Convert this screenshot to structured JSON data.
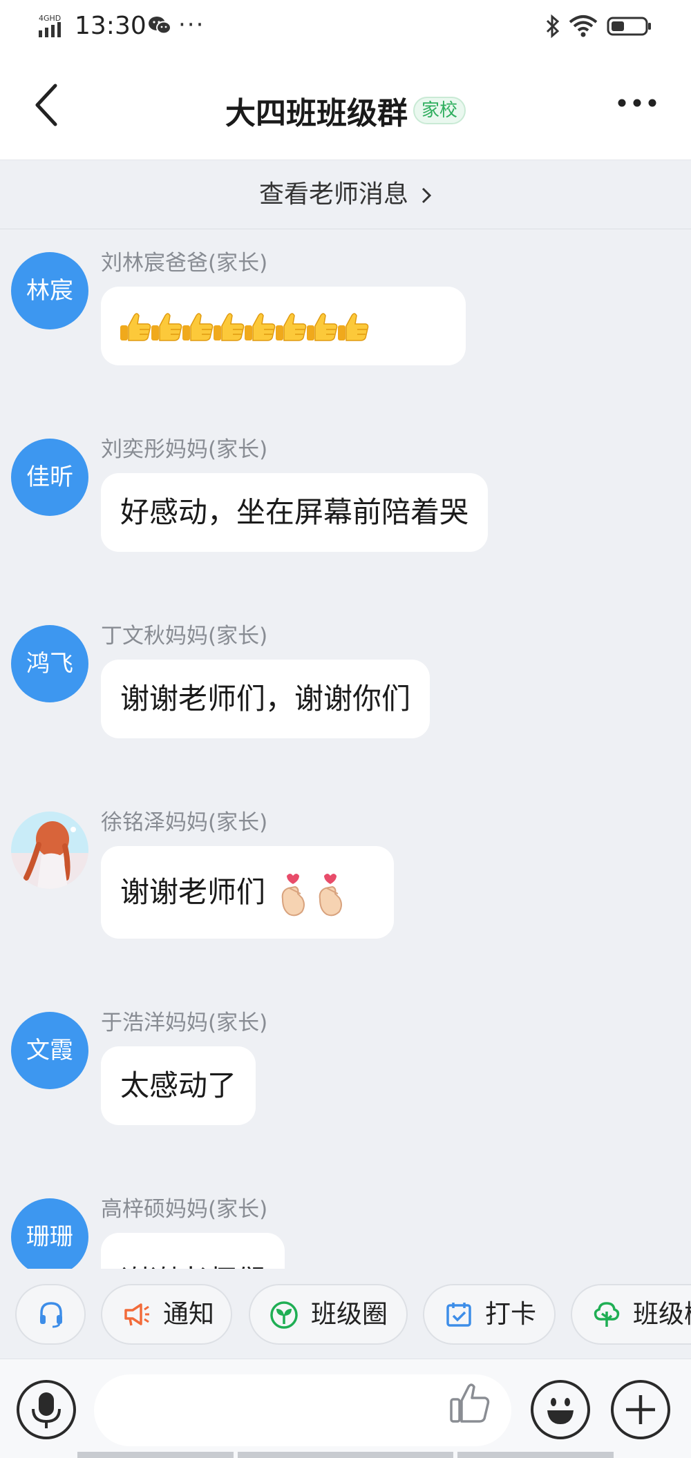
{
  "status_bar": {
    "network": "4G HD",
    "time": "13:30",
    "more": "···"
  },
  "header": {
    "title": "大四班班级群",
    "badge": "家校"
  },
  "teacher_link": {
    "label": "查看老师消息"
  },
  "messages": [
    {
      "avatar_text": "林宸",
      "sender": "刘林宸爸爸(家长)",
      "text": "",
      "emoji": "thumbs-up ×8"
    },
    {
      "avatar_text": "佳昕",
      "sender": "刘奕彤妈妈(家长)",
      "text": "好感动，坐在屏幕前陪着哭"
    },
    {
      "avatar_text": "鸿飞",
      "sender": "丁文秋妈妈(家长)",
      "text": "谢谢老师们，谢谢你们"
    },
    {
      "avatar_text": "",
      "sender": "徐铭泽妈妈(家长)",
      "text": "谢谢老师们",
      "emoji": "finger-heart ×2"
    },
    {
      "avatar_text": "文霞",
      "sender": "于浩洋妈妈(家长)",
      "text": "太感动了"
    },
    {
      "avatar_text": "珊珊",
      "sender": "高梓硕妈妈(家长)",
      "text": "谢谢老师们"
    }
  ],
  "shortcuts": [
    {
      "label": "",
      "icon": "headset-icon",
      "color": "#3d8de8"
    },
    {
      "label": "通知",
      "icon": "megaphone-icon",
      "color": "#f26b3a"
    },
    {
      "label": "班级圈",
      "icon": "sprout-icon",
      "color": "#1fae54"
    },
    {
      "label": "打卡",
      "icon": "calendar-check-icon",
      "color": "#3d8de8"
    },
    {
      "label": "班级树",
      "icon": "tree-icon",
      "color": "#1fae54"
    }
  ],
  "input": {
    "placeholder": ""
  },
  "colors": {
    "avatar_blue": "#3d97f0",
    "badge_green": "#2fae5e",
    "background": "#eef0f4"
  }
}
